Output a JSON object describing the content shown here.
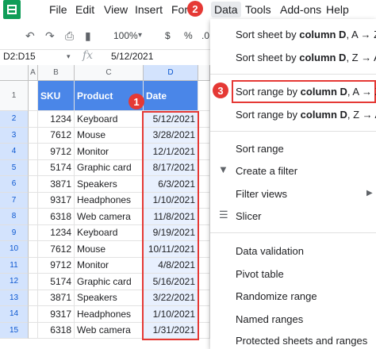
{
  "menubar": {
    "items": [
      "File",
      "Edit",
      "View",
      "Insert",
      "Forr",
      "Data",
      "Tools",
      "Add-ons",
      "Help"
    ]
  },
  "toolbar": {
    "zoom": "100%",
    "dollar": "$",
    "percent": "%",
    "decimal": ".0"
  },
  "formula_bar": {
    "name_box": "D2:D15",
    "fx": "fx",
    "value": "5/12/2021"
  },
  "columns": [
    "A",
    "B",
    "C",
    "D"
  ],
  "table": {
    "headers": [
      "SKU",
      "Product",
      "Date"
    ],
    "rows": [
      [
        "1234",
        "Keyboard",
        "5/12/2021"
      ],
      [
        "7612",
        "Mouse",
        "3/28/2021"
      ],
      [
        "9712",
        "Monitor",
        "12/1/2021"
      ],
      [
        "5174",
        "Graphic card",
        "8/17/2021"
      ],
      [
        "3871",
        "Speakers",
        "6/3/2021"
      ],
      [
        "9317",
        "Headphones",
        "1/10/2021"
      ],
      [
        "6318",
        "Web camera",
        "11/8/2021"
      ],
      [
        "1234",
        "Keyboard",
        "9/19/2021"
      ],
      [
        "7612",
        "Mouse",
        "10/11/2021"
      ],
      [
        "9712",
        "Monitor",
        "4/8/2021"
      ],
      [
        "5174",
        "Graphic card",
        "5/16/2021"
      ],
      [
        "3871",
        "Speakers",
        "3/22/2021"
      ],
      [
        "9317",
        "Headphones",
        "1/10/2021"
      ],
      [
        "6318",
        "Web camera",
        "1/31/2021"
      ]
    ]
  },
  "row_numbers": [
    "1",
    "2",
    "3",
    "4",
    "5",
    "6",
    "7",
    "8",
    "9",
    "10",
    "11",
    "12",
    "13",
    "14",
    "15"
  ],
  "badges": {
    "one": "1",
    "two": "2",
    "three": "3"
  },
  "data_menu": {
    "sort_sheet_az": {
      "pre": "Sort sheet by ",
      "bold": "column D",
      "post": ", A → Z"
    },
    "sort_sheet_za": {
      "pre": "Sort sheet by ",
      "bold": "column D",
      "post": ", Z → A"
    },
    "sort_range_az": {
      "pre": "Sort range by ",
      "bold": "column D",
      "post": ", A → Z"
    },
    "sort_range_za": {
      "pre": "Sort range by ",
      "bold": "column D",
      "post": ", Z → A"
    },
    "sort_range": "Sort range",
    "create_filter": "Create a filter",
    "filter_views": "Filter views",
    "slicer": "Slicer",
    "data_validation": "Data validation",
    "pivot_table": "Pivot table",
    "randomize_range": "Randomize range",
    "named_ranges": "Named ranges",
    "protected": "Protected sheets and ranges"
  },
  "colors": {
    "accent": "#e53935",
    "header_fill": "#4a86e8",
    "selection": "#e8f0fe"
  }
}
